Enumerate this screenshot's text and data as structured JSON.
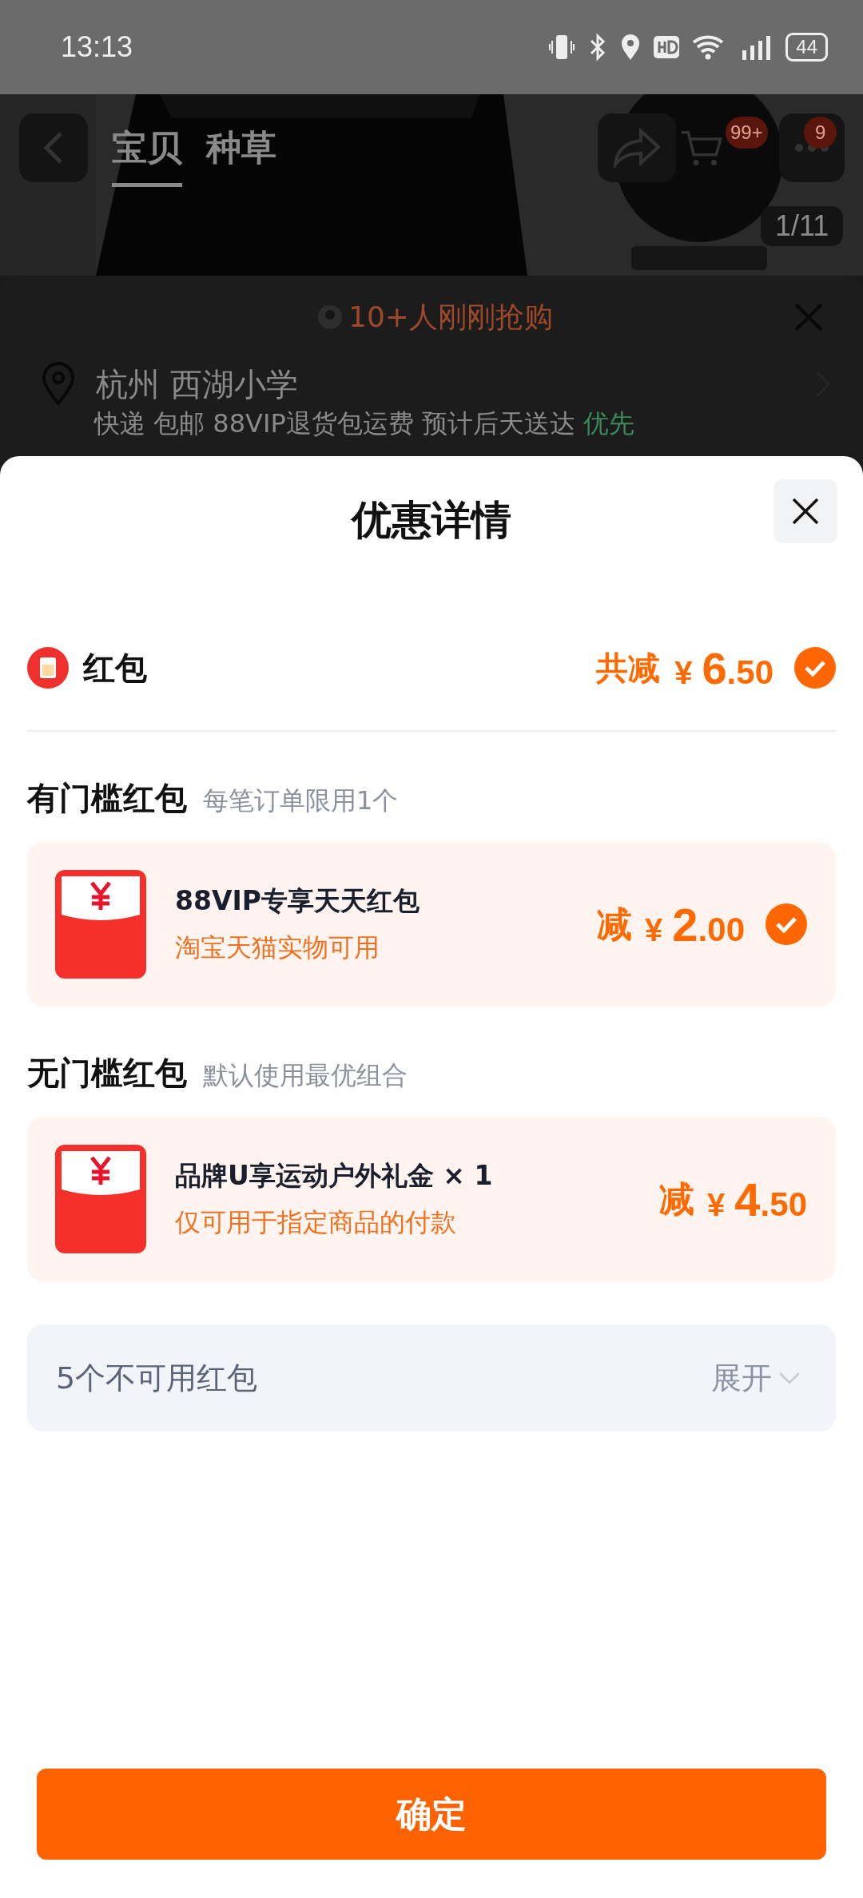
{
  "status_bar": {
    "time": "13:13",
    "battery": "44"
  },
  "background_page": {
    "tabs": [
      {
        "label": "宝贝",
        "selected": true
      },
      {
        "label": "种草",
        "selected": false
      }
    ],
    "cart_badge": "99+",
    "message_badge": "9",
    "image_counter": "1/11",
    "buyers_hint": "10+人刚刚抢购",
    "address": "杭州 西湖小学",
    "delivery": "快递 包邮 88VIP退货包运费 预计后天送达",
    "delivery_tag": "优先"
  },
  "sheet": {
    "title": "优惠详情",
    "category": {
      "label": "红包",
      "total_prefix": "共减",
      "currency": "¥",
      "amount_int": "6",
      "amount_dec": ".50",
      "checked": true
    },
    "groups": [
      {
        "title": "有门槛红包",
        "note": "每笔订单限用1个",
        "coupons": [
          {
            "name": "88VIP专享天天红包",
            "desc": "淘宝天猫实物可用",
            "prefix": "减",
            "currency": "¥",
            "amount_int": "2",
            "amount_dec": ".00",
            "checked": true
          }
        ]
      },
      {
        "title": "无门槛红包",
        "note": "默认使用最优组合",
        "coupons": [
          {
            "name": "品牌U享运动户外礼金 × 1",
            "desc": "仅可用于指定商品的付款",
            "prefix": "减",
            "currency": "¥",
            "amount_int": "4",
            "amount_dec": ".50",
            "checked": false
          }
        ]
      }
    ],
    "unavailable": {
      "label": "5个不可用红包",
      "toggle": "展开",
      "expanded": false
    },
    "confirm": "确定"
  }
}
